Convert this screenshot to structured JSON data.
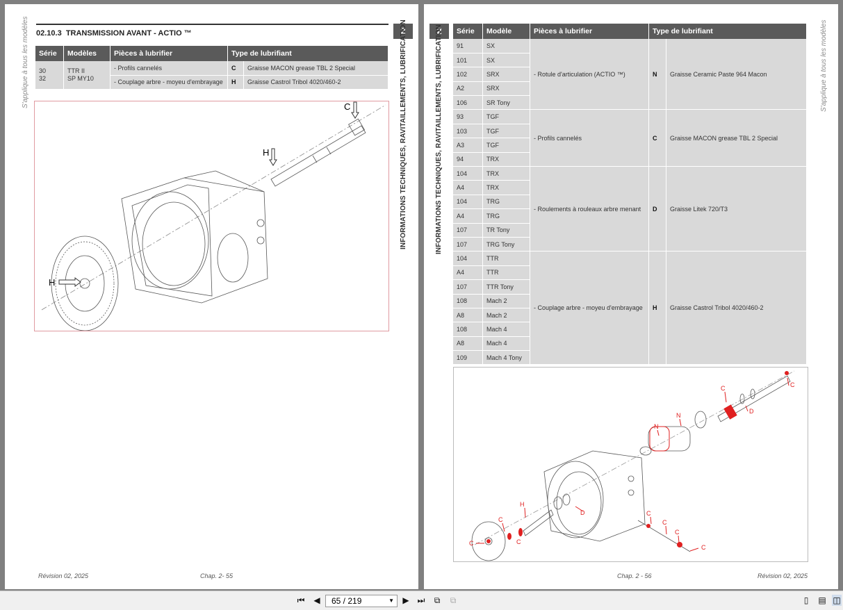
{
  "left_page": {
    "side_note": "S'applique à tous les modèles",
    "chapter_number": "2",
    "chapter_title": "INFORMATIONS TECHNIQUES, RAVITAILLEMENTS, LUBRIFICATION",
    "section_number": "02.10.3",
    "section_title": "TRANSMISSION AVANT - ACTIO ™",
    "table": {
      "headers": [
        "Série",
        "Modèles",
        "Pièces à lubrifier",
        "Type de lubrifiant"
      ],
      "series": "30\n32",
      "models": "TTR II\nSP MY10",
      "rows": [
        {
          "part": "- Profils cannelés",
          "code": "C",
          "lubricant": "Graisse MACON grease TBL 2 Special"
        },
        {
          "part": "- Couplage arbre - moyeu d'embrayage",
          "code": "H",
          "lubricant": "Graisse Castrol Tribol 4020/460-2"
        }
      ]
    },
    "figure_labels": [
      "C",
      "H",
      "H"
    ],
    "footer_left": "Révision 02, 2025",
    "footer_right": "Chap. 2- 55"
  },
  "right_page": {
    "side_note": "S'applique à tous les modèles",
    "chapter_number": "2",
    "chapter_title": "INFORMATIONS TECHNIQUES, RAVITAILLEMENTS, LUBRIFICATION",
    "table": {
      "headers": [
        "Série",
        "Modèle",
        "Pièces à lubrifier",
        "Type de lubrifiant"
      ],
      "groups": [
        {
          "rows": [
            [
              "91",
              "SX"
            ],
            [
              "101",
              "SX"
            ],
            [
              "102",
              "SRX"
            ],
            [
              "A2",
              "SRX"
            ],
            [
              "106",
              "SR Tony"
            ]
          ],
          "part": "- Rotule d'articulation (ACTIO ™)",
          "code": "N",
          "lubricant": "Graisse Ceramic Paste 964 Macon"
        },
        {
          "rows": [
            [
              "93",
              "TGF"
            ],
            [
              "103",
              "TGF"
            ],
            [
              "A3",
              "TGF"
            ],
            [
              "94",
              "TRX"
            ]
          ],
          "part": "- Profils cannelés",
          "code": "C",
          "lubricant": "Graisse MACON grease TBL 2 Special"
        },
        {
          "rows": [
            [
              "104",
              "TRX"
            ],
            [
              "A4",
              "TRX"
            ],
            [
              "104",
              "TRG"
            ],
            [
              "A4",
              "TRG"
            ],
            [
              "107",
              "TR Tony"
            ],
            [
              "107",
              "TRG Tony"
            ]
          ],
          "part": "- Roulements à rouleaux arbre menant",
          "code": "D",
          "lubricant": "Graisse Litek 720/T3"
        },
        {
          "rows": [
            [
              "104",
              "TTR"
            ],
            [
              "A4",
              "TTR"
            ],
            [
              "107",
              "TTR Tony"
            ],
            [
              "108",
              "Mach 2"
            ],
            [
              "A8",
              "Mach 2"
            ],
            [
              "108",
              "Mach 4"
            ],
            [
              "A8",
              "Mach 4"
            ],
            [
              "109",
              "Mach 4 Tony"
            ]
          ],
          "part": "- Couplage arbre - moyeu d'embrayage",
          "code": "H",
          "lubricant": "Graisse Castrol Tribol 4020/460-2"
        }
      ]
    },
    "figure_labels": [
      "C",
      "C",
      "D",
      "N",
      "N",
      "H",
      "D",
      "C",
      "C",
      "C",
      "C",
      "C",
      "C",
      "C"
    ],
    "footer_left": "Chap. 2 - 56",
    "footer_right": "Révision 02, 2025"
  },
  "toolbar": {
    "page_indicator": "65 / 219",
    "icons": [
      "first-page-icon",
      "previous-page-icon",
      "next-page-icon",
      "last-page-icon",
      "go-back-icon",
      "go-forward-icon",
      "single-page-icon",
      "continuous-page-icon",
      "facing-pages-icon"
    ]
  },
  "colors": {
    "header_bg": "#5a5a5a",
    "cell_bg": "#d9d9d9",
    "annotation_red": "#e02020",
    "viewer_bg": "#808080"
  }
}
